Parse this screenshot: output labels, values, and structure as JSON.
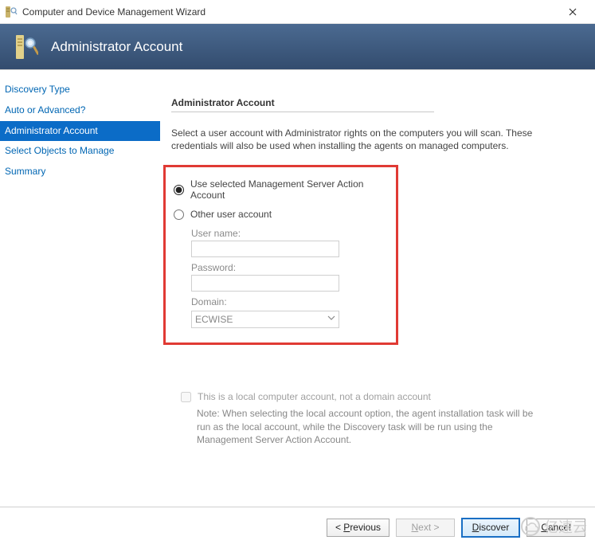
{
  "window": {
    "title": "Computer and Device Management Wizard",
    "close_icon": "✕"
  },
  "header": {
    "title": "Administrator Account"
  },
  "nav": {
    "items": [
      {
        "label": "Discovery Type",
        "selected": false
      },
      {
        "label": "Auto or Advanced?",
        "selected": false
      },
      {
        "label": "Administrator Account",
        "selected": true
      },
      {
        "label": "Select Objects to Manage",
        "selected": false
      },
      {
        "label": "Summary",
        "selected": false
      }
    ]
  },
  "content": {
    "section_title": "Administrator Account",
    "intro": "Select a user account with Administrator rights on the computers you will scan. These credentials will also be used when installing the agents on managed computers.",
    "radio_selected": "Use selected Management Server Action Account",
    "radio_other": "Other user account",
    "username_label": "User name:",
    "username_value": "",
    "password_label": "Password:",
    "password_value": "",
    "domain_label": "Domain:",
    "domain_value": "ECWISE",
    "local_account_label": "This is a local computer account, not a domain account",
    "note": "Note:  When selecting the local account option, the agent installation task will be run as the local account, while the Discovery task will be run using the Management Server Action Account."
  },
  "footer": {
    "previous": "Previous",
    "next": "Next >",
    "discover": "Discover",
    "cancel": "Cancel"
  },
  "watermark": "亿速云"
}
